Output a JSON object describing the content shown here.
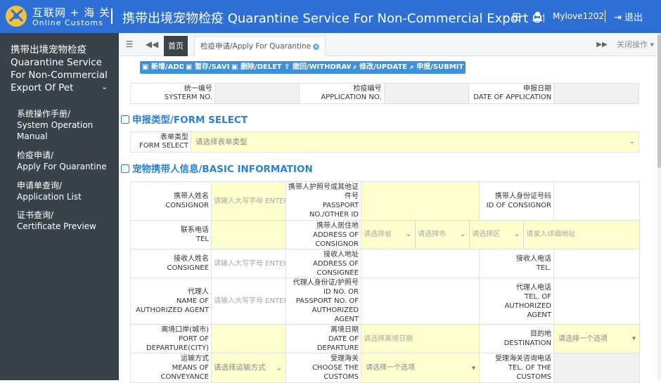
{
  "header": {
    "brand_cn": "互联网 + 海 关",
    "brand_en": "Online Customs",
    "system_title": "携带出境宠物检疫 Quarantine Service For Non-Commercial Export Of Pet",
    "username": "Mylove1202",
    "logout_label": "退出",
    "color": "#2d6fd4"
  },
  "sidebar": {
    "title": "携带出境宠物检疫 Quarantine Service For Non-Commercial Export Of Pet",
    "items": [
      {
        "cn": "系统操作手册/",
        "en": "System Operation Manual"
      },
      {
        "cn": "检疫申请/",
        "en": "Apply For Quarantine"
      },
      {
        "cn": "申请单查询/",
        "en": "Application List"
      },
      {
        "cn": "证书查询/",
        "en": "Certificate Preview"
      }
    ]
  },
  "tabs": {
    "home": "首页",
    "active": "检疫申请/Apply For Quarantine",
    "close_ops": "关闭操作"
  },
  "toolbar": {
    "add": "新增/ADD",
    "save": "暂存/SAVE",
    "delete": "删除/DELETE",
    "withdraw": "撤回/WITHDRAW",
    "update": "修改/UPDATE",
    "submit": "申报/SUBMIT"
  },
  "info": {
    "system_no_cn": "统一编号",
    "system_no_en": "SYSTERM NO.",
    "app_no_cn": "检疫编号",
    "app_no_en": "APPLICATION NO.",
    "date_cn": "申报日期",
    "date_en": "DATE OF APPLICATION"
  },
  "section_form_select": "申报类型/FORM SELECT",
  "form_select": {
    "label_cn": "表单类型",
    "label_en": "FORM SELECT",
    "placeholder": "请选择表单类型"
  },
  "section_basic": "宠物携带人信息/BASIC INFORMATION",
  "basic": {
    "consignor_name_cn": "携带人姓名",
    "consignor_name_en": "CONSIGNOR",
    "ph_upper": "请输入大写字母 ENTER IN CAPITAL LETTERS",
    "passport_cn": "携带人护照号或其他证件号",
    "passport_en": "PASSPORT NO./OTHER ID",
    "id_cn": "携带人身份证号码",
    "id_en": "ID OF CONSIGNOR",
    "tel_cn": "联系电话",
    "tel_en": "TEL",
    "address_cn": "携带人居住地",
    "address_en": "ADDRESS OF CONSIGNOR",
    "province_ph": "请选择省",
    "city_ph": "请选择市",
    "district_ph": "请选择区",
    "detail_ph": "请录入详细地址",
    "consignee_name_cn": "接收人姓名",
    "consignee_name_en": "CONSIGNEE",
    "consignee_addr_cn": "接收人地址",
    "consignee_addr_en": "ADDRESS OF CONSIGNEE",
    "consignee_tel_cn": "接收人电话",
    "consignee_tel_en": "TEL.",
    "agent_cn": "代理人",
    "agent_en": "NAME OF AUTHORIZED AGENT",
    "agent_id_cn": "代理人身份证/护照号",
    "agent_id_en": "ID NO. OR PASSPORT NO. OF AUTHORIZED AGENT",
    "agent_tel_cn": "代理人电话",
    "agent_tel_en": "TEL. OF AUTHORIZED AGENT",
    "port_cn": "离境口岸(城市)",
    "port_en": "PORT OF DEPARTURE(CITY)",
    "depdate_cn": "离境日期",
    "depdate_en": "DATE OF DEPARTURE",
    "depdate_ph": "请选择离境日期",
    "dest_cn": "目的地",
    "dest_en": "DESTINATION",
    "dest_ph": "请选择一个选项",
    "means_cn": "运输方式",
    "means_en": "MEANS OF CONVEYANCE",
    "means_ph": "请选择运输方式",
    "customs_cn": "受理海关",
    "customs_en": "CHOOSE THE CUSTOMS",
    "customs_ph": "请选择一个选项",
    "customs_tel_cn": "受理海关咨询电话",
    "customs_tel_en": "TEL. OF THE CUSTOMS"
  }
}
